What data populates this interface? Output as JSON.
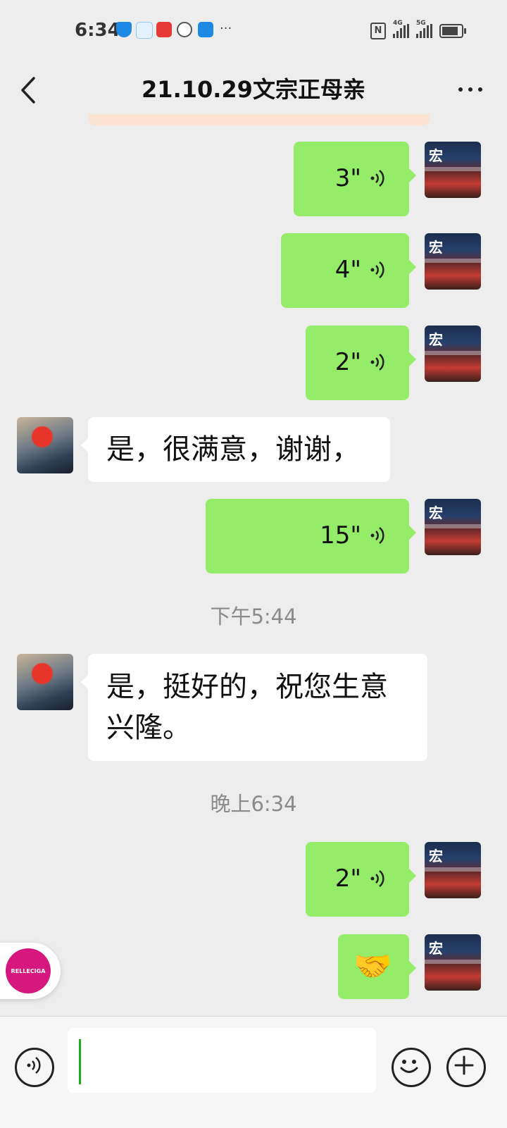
{
  "status_bar": {
    "time": "6:34",
    "network_1": "4G",
    "network_2": "5G",
    "more_indicator": "···"
  },
  "header": {
    "title": "21.10.29文宗正母亲"
  },
  "messages": [
    {
      "side": "right",
      "type": "voice",
      "duration": "3\""
    },
    {
      "side": "right",
      "type": "voice",
      "duration": "4\""
    },
    {
      "side": "right",
      "type": "voice",
      "duration": "2\""
    },
    {
      "side": "left",
      "type": "text",
      "text": "是，很满意，谢谢，"
    },
    {
      "side": "right",
      "type": "voice",
      "duration": "15\""
    },
    {
      "type": "timestamp",
      "text": "下午5:44"
    },
    {
      "side": "left",
      "type": "text",
      "text": "是，挺好的，祝您生意兴隆。"
    },
    {
      "type": "timestamp",
      "text": "晚上6:34"
    },
    {
      "side": "right",
      "type": "voice",
      "duration": "2\""
    },
    {
      "side": "right",
      "type": "emoji",
      "text": "🤝"
    }
  ],
  "floating_badge": {
    "text": "RELLECIGA"
  },
  "colors": {
    "sent_bubble": "#95ec69",
    "received_bubble": "#ffffff",
    "background": "#ededed"
  },
  "icons": [
    "back-arrow-icon",
    "more-dots-icon",
    "voice-wave-icon",
    "voice-input-icon",
    "emoji-icon",
    "plus-icon"
  ]
}
